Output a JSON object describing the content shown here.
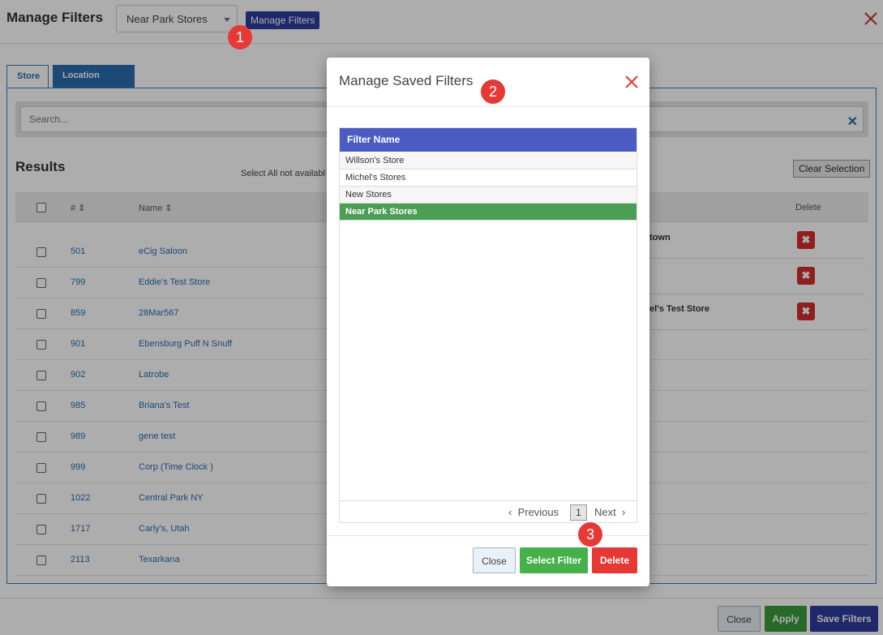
{
  "header": {
    "title": "Manage Filters",
    "selected_filter": "Near Park Stores",
    "manage_button": "Manage Filters"
  },
  "callouts": [
    "1",
    "2",
    "3"
  ],
  "tabs": [
    {
      "label": "Store",
      "active": true
    },
    {
      "label": "Location Group",
      "active": false
    }
  ],
  "search": {
    "placeholder": "Search..."
  },
  "results": {
    "title": "Results",
    "select_all_note": "Select All not availabl",
    "clear_selection": "Clear Selection",
    "columns": {
      "num": "#",
      "name": "Name",
      "delete": "Delete"
    },
    "rows": [
      {
        "num": "501",
        "name": "eCig Saloon"
      },
      {
        "num": "799",
        "name": "Eddie's Test Store"
      },
      {
        "num": "859",
        "name": "28Mar567"
      },
      {
        "num": "901",
        "name": "Ebensburg Puff N Snuff"
      },
      {
        "num": "902",
        "name": "Latrobe"
      },
      {
        "num": "985",
        "name": "Briana's Test"
      },
      {
        "num": "989",
        "name": "gene test"
      },
      {
        "num": "999",
        "name": "Corp (Time Clock )"
      },
      {
        "num": "1022",
        "name": "Central Park NY"
      },
      {
        "num": "1717",
        "name": "Carly's, Utah"
      },
      {
        "num": "2113",
        "name": "Texarkana"
      }
    ],
    "selected": [
      {
        "label": "town"
      },
      {
        "label": ""
      },
      {
        "label": "el's Test Store"
      }
    ]
  },
  "footer": {
    "close": "Close",
    "apply": "Apply",
    "save": "Save Filters"
  },
  "modal": {
    "title": "Manage Saved Filters",
    "column": "Filter Name",
    "filters": [
      {
        "name": "Willson's Store",
        "selected": false
      },
      {
        "name": "Michel's Stores",
        "selected": false
      },
      {
        "name": "New Stores",
        "selected": false
      },
      {
        "name": "Near Park Stores",
        "selected": true
      }
    ],
    "pagination": {
      "previous": "Previous",
      "page": "1",
      "next": "Next"
    },
    "buttons": {
      "close": "Close",
      "select": "Select Filter",
      "delete": "Delete"
    }
  },
  "colors": {
    "accent_blue": "#2b6cb0",
    "navy": "#2d3c9c",
    "header_blue": "#4a5bc4",
    "selected_green": "#4c9e55",
    "danger_red": "#e53935"
  }
}
